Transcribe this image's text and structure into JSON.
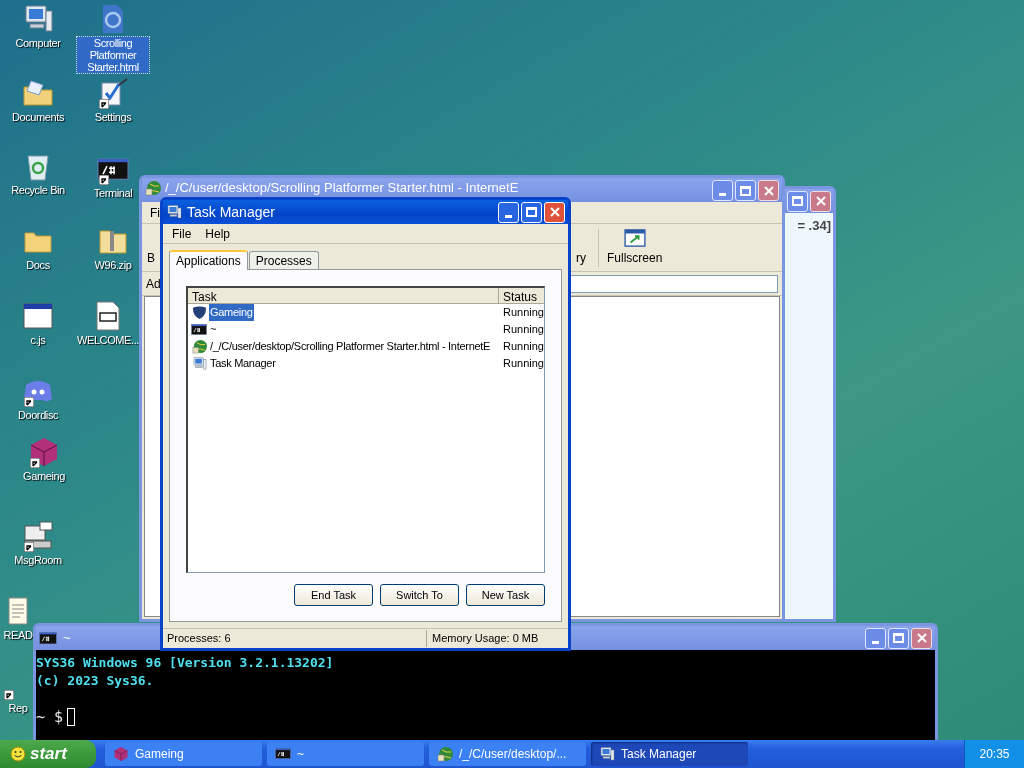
{
  "desktop_icons": [
    {
      "label": "Computer",
      "kind": "computer",
      "selected": false,
      "shortcut": false
    },
    {
      "label": "Scrolling Platformer Starter.html",
      "kind": "html",
      "selected": true,
      "shortcut": false
    },
    {
      "label": "Documents",
      "kind": "documents",
      "selected": false,
      "shortcut": false
    },
    {
      "label": "Settings",
      "kind": "settings",
      "selected": false,
      "shortcut": true
    },
    {
      "label": "Recycle Bin",
      "kind": "recycle",
      "selected": false,
      "shortcut": false
    },
    {
      "label": "Terminal",
      "kind": "terminal",
      "selected": false,
      "shortcut": true
    },
    {
      "label": "Docs",
      "kind": "folder",
      "selected": false,
      "shortcut": false
    },
    {
      "label": "W96.zip",
      "kind": "zip",
      "selected": false,
      "shortcut": false
    },
    {
      "label": "c.js",
      "kind": "window",
      "selected": false,
      "shortcut": false
    },
    {
      "label": "WELCOME...",
      "kind": "markdown",
      "selected": false,
      "shortcut": false
    },
    {
      "label": "Doordisc",
      "kind": "chat",
      "selected": false,
      "shortcut": true
    },
    {
      "label": "Gameing",
      "kind": "cube",
      "selected": false,
      "shortcut": true
    },
    {
      "label": "MsgRoom",
      "kind": "msgroom",
      "selected": false,
      "shortcut": true
    },
    {
      "label": "READ",
      "kind": "notepad",
      "selected": false,
      "shortcut": false
    },
    {
      "label": "Rep",
      "kind": "none",
      "selected": false,
      "shortcut": true
    }
  ],
  "background_window": {
    "active": false,
    "text": "= .34]"
  },
  "browser_window": {
    "title": "/_/C/user/desktop/Scrolling Platformer Starter.html - InternetE",
    "active": false,
    "menu": "Fi",
    "toolbar": [
      {
        "label": "B",
        "kind": "partial"
      },
      {
        "label": "ry",
        "kind": "partial"
      },
      {
        "label": "Fullscreen",
        "kind": "fullscreen"
      }
    ],
    "address_label": "Ad"
  },
  "terminal": {
    "title": "~",
    "active": false,
    "lines": [
      "SYS36 Windows 96 [Version 3.2.1.13202]",
      "(c) 2023 Sys36."
    ],
    "prompt": "~ $"
  },
  "task_manager": {
    "title": "Task Manager",
    "active": true,
    "menu": [
      "File",
      "Help"
    ],
    "tabs": [
      {
        "label": "Applications",
        "selected": true
      },
      {
        "label": "Processes",
        "selected": false
      }
    ],
    "columns": [
      "Task",
      "Status"
    ],
    "rows": [
      {
        "task": "Gameing",
        "status": "Running",
        "kind": "shield",
        "selected": true
      },
      {
        "task": "~",
        "status": "Running",
        "kind": "terminal",
        "selected": false
      },
      {
        "task": "/_/C/user/desktop/Scrolling Platformer Starter.html - InternetE",
        "status": "Running",
        "kind": "globe",
        "selected": false
      },
      {
        "task": "Task Manager",
        "status": "Running",
        "kind": "computer",
        "selected": false
      }
    ],
    "buttons": [
      "End Task",
      "Switch To",
      "New Task"
    ],
    "status_bar": [
      "Processes: 6",
      "Memory Usage: 0 MB"
    ]
  },
  "taskbar": {
    "start": "start",
    "items": [
      {
        "label": "Gameing",
        "kind": "cube",
        "selected": false
      },
      {
        "label": "~",
        "kind": "terminal",
        "selected": false
      },
      {
        "label": "/_/C/user/desktop/...",
        "kind": "globe",
        "selected": false
      },
      {
        "label": "Task Manager",
        "kind": "computer",
        "selected": true
      }
    ],
    "clock": "20:35"
  }
}
